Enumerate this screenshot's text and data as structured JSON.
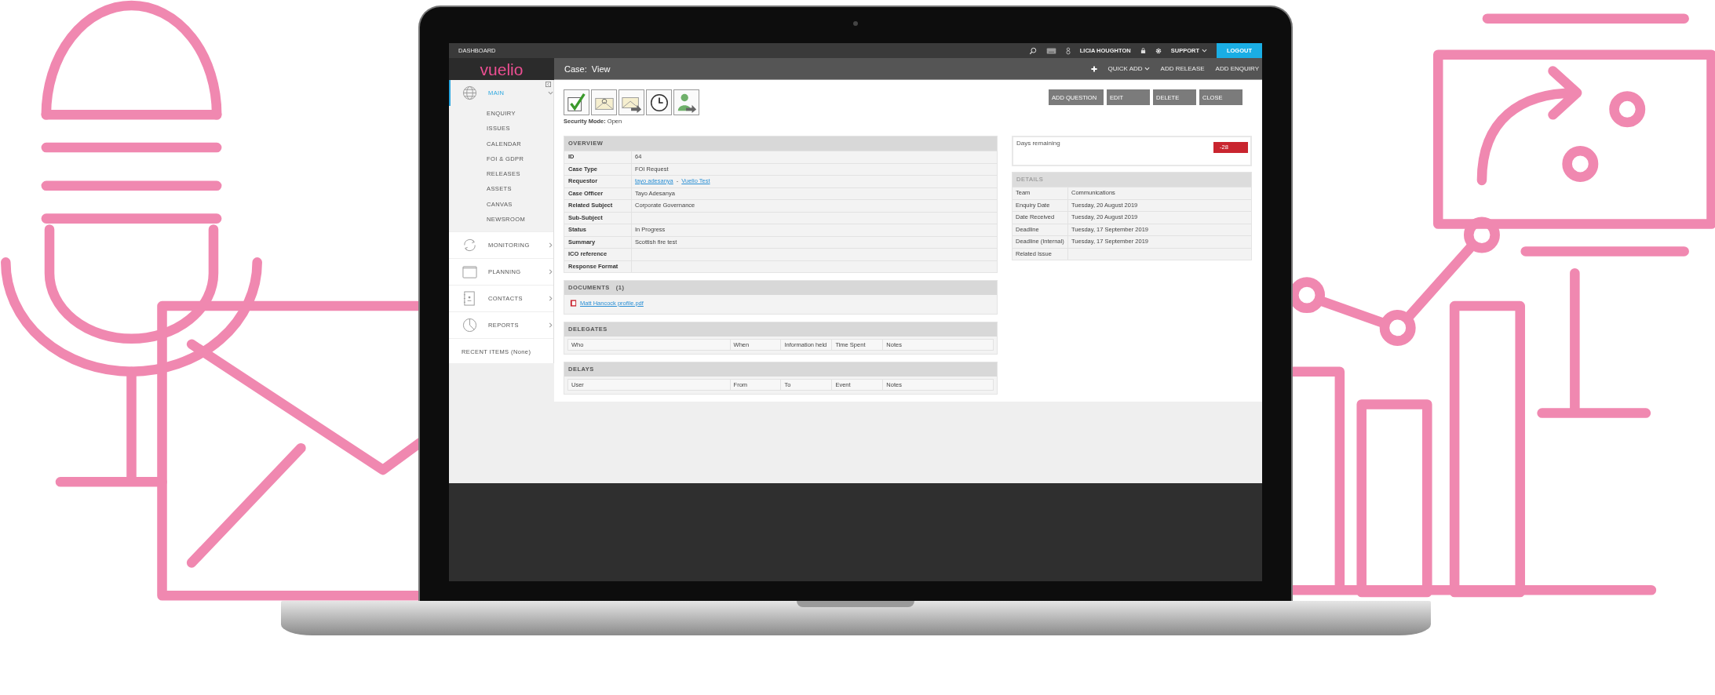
{
  "top_bar": {
    "dashboard": "DASHBOARD",
    "user": "LICIA HOUGHTON",
    "support": "SUPPORT",
    "logout": "LOGOUT"
  },
  "header": {
    "logo": "vuelio",
    "title": "Case:  View",
    "actions": [
      "QUICK ADD",
      "ADD RELEASE",
      "ADD ENQUIRY"
    ]
  },
  "sidebar": {
    "sections": [
      {
        "label": "MAIN",
        "selected": true,
        "expanded": true,
        "children": [
          {
            "label": "ENQUIRY"
          },
          {
            "label": "ISSUES"
          },
          {
            "label": "CALENDAR"
          },
          {
            "label": "FOI & GDPR"
          },
          {
            "label": "RELEASES"
          },
          {
            "label": "ASSETS"
          },
          {
            "label": "CANVAS"
          },
          {
            "label": "NEWSROOM"
          }
        ]
      },
      {
        "label": "MONITORING",
        "selected": false,
        "expanded": false
      },
      {
        "label": "PLANNING",
        "selected": false,
        "expanded": false
      },
      {
        "label": "CONTACTS",
        "selected": false,
        "expanded": false
      },
      {
        "label": "REPORTS",
        "selected": false,
        "expanded": false
      }
    ],
    "recent": "RECENT ITEMS (None)"
  },
  "security_mode": {
    "label": "Security Mode:",
    "value": "Open"
  },
  "buttons": [
    "ADD QUESTION",
    "EDIT",
    "DELETE",
    "CLOSE"
  ],
  "overview": {
    "title": "OVERVIEW",
    "rows": [
      {
        "label": "ID",
        "kind": "text",
        "value": "64"
      },
      {
        "label": "Case Type",
        "kind": "text",
        "value": "FOI Request"
      },
      {
        "label": "Requestor",
        "kind": "links",
        "links": [
          "tayo adesanya",
          "Vuelio Test"
        ],
        "separator": "-"
      },
      {
        "label": "Case Officer",
        "kind": "text",
        "value": "Tayo Adesanya"
      },
      {
        "label": "Related Subject",
        "kind": "text",
        "value": "Corporate Governance"
      },
      {
        "label": "Sub-Subject",
        "kind": "text"
      },
      {
        "label": "Status",
        "kind": "text",
        "value": "In Progress"
      },
      {
        "label": "Summary",
        "kind": "text",
        "value": "Scottish fire test"
      },
      {
        "label": "ICO reference",
        "kind": "text"
      },
      {
        "label": "Response Format",
        "kind": "text"
      }
    ]
  },
  "documents": {
    "title": "DOCUMENTS",
    "count": "(1)",
    "files": [
      "Matt Hancock profile.pdf"
    ]
  },
  "delegates": {
    "title": "DELEGATES",
    "columns": [
      "Who",
      "When",
      "Information held",
      "Time Spent",
      "Notes"
    ]
  },
  "delays": {
    "title": "DELAYS",
    "columns": [
      "User",
      "From",
      "To",
      "Event",
      "Notes"
    ]
  },
  "days_remaining": {
    "label": "Days remaining",
    "value": "-28"
  },
  "details": {
    "title": "DETAILS",
    "rows": [
      {
        "label": "Team",
        "value": "Communications"
      },
      {
        "label": "Enquiry Date",
        "value": "Tuesday, 20 August 2019"
      },
      {
        "label": "Date Received",
        "value": "Tuesday, 20 August 2019"
      },
      {
        "label": "Deadline",
        "value": "Tuesday, 17 September 2019"
      },
      {
        "label": "Deadline (Internal)",
        "value": "Tuesday, 17 September 2019"
      },
      {
        "label": "Related Issue"
      }
    ]
  }
}
